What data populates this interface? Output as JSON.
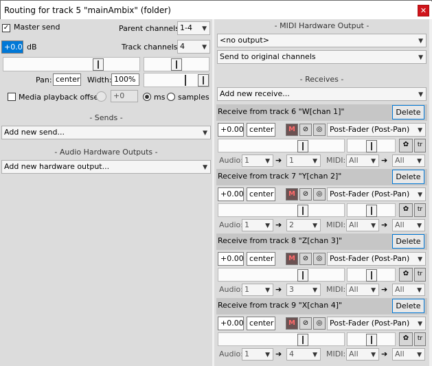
{
  "window": {
    "title": "Routing for track 5 \"mainAmbix\" (folder)",
    "close": "✕"
  },
  "master": {
    "checkbox_label": "Master send",
    "checked": true,
    "volume": "+0.00",
    "unit": "dB",
    "parent_channels_label": "Parent channels:",
    "parent_channels": "1-4",
    "track_channels_label": "Track channels:",
    "track_channels": "4",
    "pan_label": "Pan:",
    "pan": "center",
    "width_label": "Width:",
    "width": "100%",
    "playback_offset_label": "Media playback offset:",
    "offset_value": "+0",
    "unit_ms": "ms",
    "unit_samples": "samples",
    "unit_selected": "ms"
  },
  "sends": {
    "header": "Sends",
    "add_label": "Add new send..."
  },
  "hw_outputs": {
    "header": "Audio Hardware Outputs",
    "add_label": "Add new hardware output..."
  },
  "midi_hw": {
    "header": "MIDI Hardware Output",
    "output": "<no output>",
    "channels": "Send to original channels"
  },
  "receives": {
    "header": "Receives",
    "add_label": "Add new receive...",
    "delete_label": "Delete",
    "audio_label": "Audio:",
    "midi_label": "MIDI:",
    "arrow": "➔",
    "mode": "Post-Fader (Post-Pan)",
    "mute_glyph": "M",
    "items": [
      {
        "title": "Receive from track 6 \"W[chan 1]\"",
        "volume": "+0.00",
        "pan": "center",
        "audio_src": "1",
        "audio_dst": "1",
        "midi_src": "All",
        "midi_dst": "All"
      },
      {
        "title": "Receive from track 7 \"Y[chan 2]\"",
        "volume": "+0.00",
        "pan": "center",
        "audio_src": "1",
        "audio_dst": "2",
        "midi_src": "All",
        "midi_dst": "All"
      },
      {
        "title": "Receive from track 8 \"Z[chan 3]\"",
        "volume": "+0.00",
        "pan": "center",
        "audio_src": "1",
        "audio_dst": "3",
        "midi_src": "All",
        "midi_dst": "All"
      },
      {
        "title": "Receive from track 9 \"X[chan 4]\"",
        "volume": "+0.00",
        "pan": "center",
        "audio_src": "1",
        "audio_dst": "4",
        "midi_src": "All",
        "midi_dst": "All"
      }
    ]
  },
  "colors": {
    "close": "#d0141b",
    "focus": "#0078d7",
    "mute": "#6b5252"
  }
}
